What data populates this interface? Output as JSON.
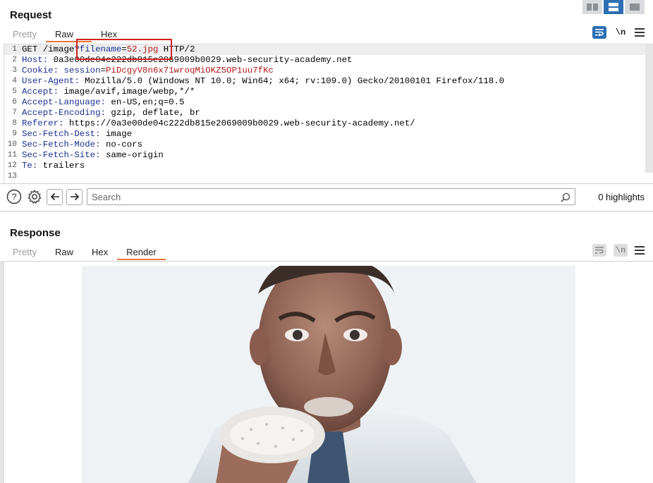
{
  "layout_switch": {
    "options": [
      "split-vertical-icon",
      "split-horizontal-icon",
      "single-pane-icon"
    ],
    "active_index": 1,
    "accent": "#2c6fb3"
  },
  "request": {
    "title": "Request",
    "tabs": [
      {
        "label": "Pretty",
        "state": "dim"
      },
      {
        "label": "Raw",
        "state": "active"
      },
      {
        "label": "Hex",
        "state": "normal"
      }
    ],
    "tools": {
      "wrap_icon": "wrap-lines-icon",
      "newline_label": "\\n",
      "menu_icon": "hamburger-menu-icon"
    },
    "lines": [
      {
        "num": "1",
        "parts": [
          [
            "",
            "GET /image"
          ],
          [
            "pk",
            "?filename"
          ],
          [
            "",
            "="
          ],
          [
            "pv",
            "52.jpg"
          ],
          [
            "",
            " HTTP/2"
          ]
        ]
      },
      {
        "num": "2",
        "parts": [
          [
            "hk",
            "Host:"
          ],
          [
            "",
            " 0a3e00de04c222db815e2069009b0029.web-security-academy.net"
          ]
        ]
      },
      {
        "num": "3",
        "parts": [
          [
            "hk",
            "Cookie:"
          ],
          [
            "",
            " "
          ],
          [
            "pk",
            "session"
          ],
          [
            "",
            "="
          ],
          [
            "pv",
            "PiDcgyV8n6x71wroqMiOKZ5OP1uu7fKc"
          ]
        ]
      },
      {
        "num": "4",
        "parts": [
          [
            "hk",
            "User-Agent:"
          ],
          [
            "",
            " Mozilla/5.0 (Windows NT 10.0; Win64; x64; rv:109.0) Gecko/20100101 Firefox/118.0"
          ]
        ]
      },
      {
        "num": "5",
        "parts": [
          [
            "hk",
            "Accept:"
          ],
          [
            "",
            " image/avif,image/webp,*/*"
          ]
        ]
      },
      {
        "num": "6",
        "parts": [
          [
            "hk",
            "Accept-Language:"
          ],
          [
            "",
            " en-US,en;q=0.5"
          ]
        ]
      },
      {
        "num": "7",
        "parts": [
          [
            "hk",
            "Accept-Encoding:"
          ],
          [
            "",
            " gzip, deflate, br"
          ]
        ]
      },
      {
        "num": "8",
        "parts": [
          [
            "hk",
            "Referer:"
          ],
          [
            "",
            " https://0a3e00de04c222db815e2069009b0029.web-security-academy.net/"
          ]
        ]
      },
      {
        "num": "9",
        "parts": [
          [
            "hk",
            "Sec-Fetch-Dest:"
          ],
          [
            "",
            " image"
          ]
        ]
      },
      {
        "num": "10",
        "parts": [
          [
            "hk",
            "Sec-Fetch-Mode:"
          ],
          [
            "",
            " no-cors"
          ]
        ]
      },
      {
        "num": "11",
        "parts": [
          [
            "hk",
            "Sec-Fetch-Site:"
          ],
          [
            "",
            " same-origin"
          ]
        ]
      },
      {
        "num": "12",
        "parts": [
          [
            "hk",
            "Te:"
          ],
          [
            "",
            " trailers"
          ]
        ]
      },
      {
        "num": "13",
        "parts": []
      }
    ],
    "highlight_color": "#d62020"
  },
  "search": {
    "help_icon": "help-icon",
    "settings_icon": "gear-icon",
    "prev_icon": "arrow-left-icon",
    "next_icon": "arrow-right-icon",
    "placeholder": "Search",
    "search_icon": "magnifier-icon",
    "highlights_label": "0 highlights"
  },
  "response": {
    "title": "Response",
    "tabs": [
      {
        "label": "Pretty",
        "state": "dim"
      },
      {
        "label": "Raw",
        "state": "normal"
      },
      {
        "label": "Hex",
        "state": "normal"
      },
      {
        "label": "Render",
        "state": "active"
      }
    ],
    "tools": {
      "wrap_icon": "wrap-lines-icon",
      "newline_label": "\\n",
      "menu_icon": "hamburger-menu-icon"
    },
    "render_content": "photo-of-man-eating-donut"
  }
}
